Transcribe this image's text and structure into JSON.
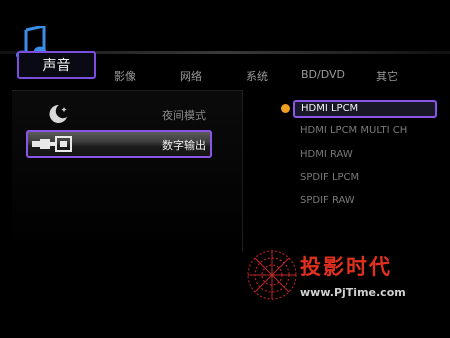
{
  "tabs": [
    {
      "label": "声音",
      "active": true
    },
    {
      "label": "影像"
    },
    {
      "label": "网络"
    },
    {
      "label": "系统"
    },
    {
      "label": "BD/DVD"
    },
    {
      "label": "其它"
    }
  ],
  "settings": {
    "items": [
      {
        "label": "夜间模式",
        "icon": "moon-icon"
      },
      {
        "label": "数字输出",
        "icon": "digital-plug-icon",
        "selected": true
      }
    ]
  },
  "options": {
    "items": [
      {
        "label": "HDMI LPCM",
        "selected": true
      },
      {
        "label": "HDMI LPCM MULTI CH"
      },
      {
        "label": "HDMI RAW"
      },
      {
        "label": "SPDIF LPCM"
      },
      {
        "label": "SPDIF RAW"
      }
    ]
  },
  "watermark": {
    "text": "投影时代",
    "url": "www.PjTime.com"
  },
  "colors": {
    "accent": "#8a56e8",
    "bullet": "#f0a020",
    "watermark_red": "#e0301e"
  }
}
